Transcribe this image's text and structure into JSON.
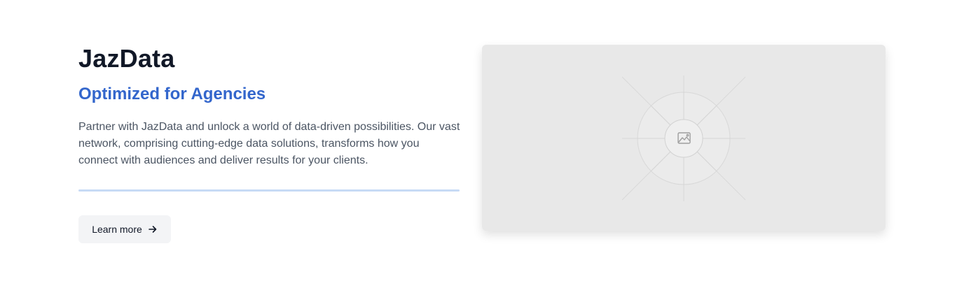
{
  "hero": {
    "title": "JazData",
    "subtitle": "Optimized for Agencies",
    "description": "Partner with JazData and unlock a world of data-driven possibilities. Our vast network, comprising cutting-edge data solutions, transforms how you connect with audiences and deliver results for your clients.",
    "cta_label": "Learn more"
  },
  "colors": {
    "accent": "#3366cc",
    "divider": "#c7daf5",
    "placeholder_bg": "#e8e8e8"
  },
  "icons": {
    "cta": "arrow-right-icon",
    "media": "image-icon"
  }
}
